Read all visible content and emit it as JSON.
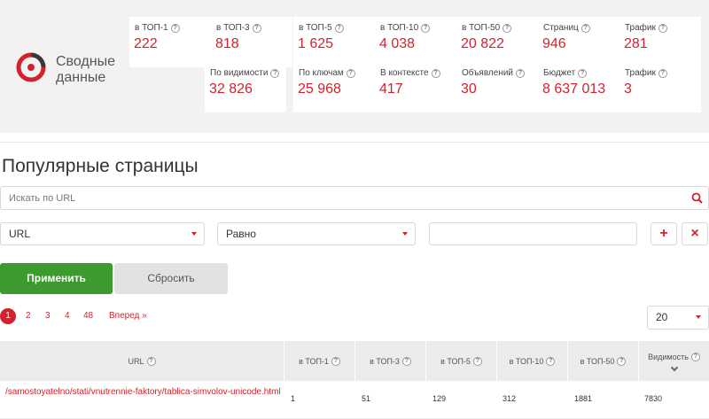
{
  "summary": {
    "title_line1": "Сводные",
    "title_line2": "данные",
    "cards_row1": [
      {
        "label": "в ТОП-1",
        "value": "222"
      },
      {
        "label": "в ТОП-3",
        "value": "818"
      },
      {
        "label": "в ТОП-5",
        "value": "1 625"
      },
      {
        "label": "в ТОП-10",
        "value": "4 038"
      },
      {
        "label": "в ТОП-50",
        "value": "20 822"
      },
      {
        "label": "Страниц",
        "value": "946"
      },
      {
        "label": "Трафик",
        "value": "281"
      }
    ],
    "cards_row2": [
      {
        "label": "По видимости",
        "value": "32 826"
      },
      {
        "label": "По ключам",
        "value": "25 968"
      },
      {
        "label": "В контексте",
        "value": "417"
      },
      {
        "label": "Объявлений",
        "value": "30"
      },
      {
        "label": "Бюджет",
        "value": "8 637 013"
      },
      {
        "label": "Трафик",
        "value": "3"
      }
    ],
    "help_glyph": "?"
  },
  "page_title": "Популярные страницы",
  "search": {
    "placeholder": "Искать по URL",
    "icon": "search-icon"
  },
  "filter": {
    "field_value": "URL",
    "operator_value": "Равно",
    "input_value": "",
    "add_label": "+",
    "remove_label": "×"
  },
  "buttons": {
    "apply": "Применить",
    "reset": "Сбросить"
  },
  "pagination": {
    "pages": [
      "1",
      "2",
      "3",
      "4",
      "48"
    ],
    "next": "Вперед »",
    "per_page": "20"
  },
  "table": {
    "headers": [
      "URL",
      "в ТОП-1",
      "в ТОП-3",
      "в ТОП-5",
      "в ТОП-10",
      "в ТОП-50",
      "Видимость"
    ],
    "rows": [
      {
        "url": "/samostoyatelno/stati/vnutrennie-faktory/tablica-simvolov-unicode.html",
        "top1": "1",
        "top3": "51",
        "top5": "129",
        "top10": "312",
        "top50": "1881",
        "visibility": "7830"
      }
    ]
  },
  "colors": {
    "accent": "#d2222d",
    "apply": "#3d9a2e",
    "panel": "#f2f2f2"
  }
}
